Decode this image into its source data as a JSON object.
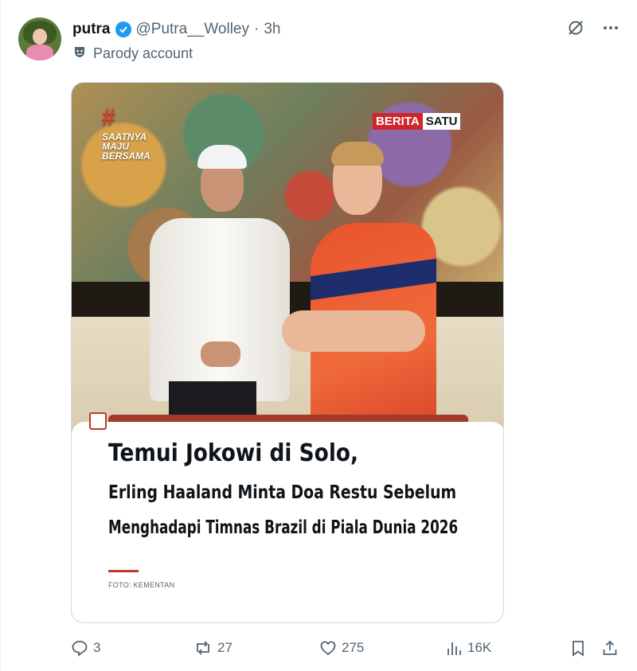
{
  "author": {
    "display_name": "putra",
    "handle": "@Putra__Wolley",
    "separator": "·",
    "time": "3h",
    "label": "Parody account"
  },
  "media": {
    "overlay_left": [
      "SAATNYA",
      "MAJU",
      "BERSAMA"
    ],
    "overlay_brand_1": "BERITA",
    "overlay_brand_2": "SATU",
    "headline_line1": "Temui Jokowi di Solo,",
    "headline_line2": "Erling Haaland Minta Doa Restu Sebelum",
    "headline_line3": "Menghadapi Timnas Brazil di Piala Dunia 2026",
    "photo_credit": "FOTO: KEMENTAN"
  },
  "stats": {
    "replies": "3",
    "reposts": "27",
    "likes": "275",
    "views": "16K"
  },
  "icons": {
    "verified": "verified-badge-icon",
    "grok": "grok-icon",
    "more": "more-icon",
    "parody": "parody-mask-icon",
    "reply": "reply-icon",
    "repost": "repost-icon",
    "like": "heart-icon",
    "views": "views-icon",
    "bookmark": "bookmark-icon",
    "share": "share-icon"
  },
  "colors": {
    "accent": "#1d9bf0",
    "secondary_text": "#536471",
    "brand_red": "#d0262b"
  }
}
